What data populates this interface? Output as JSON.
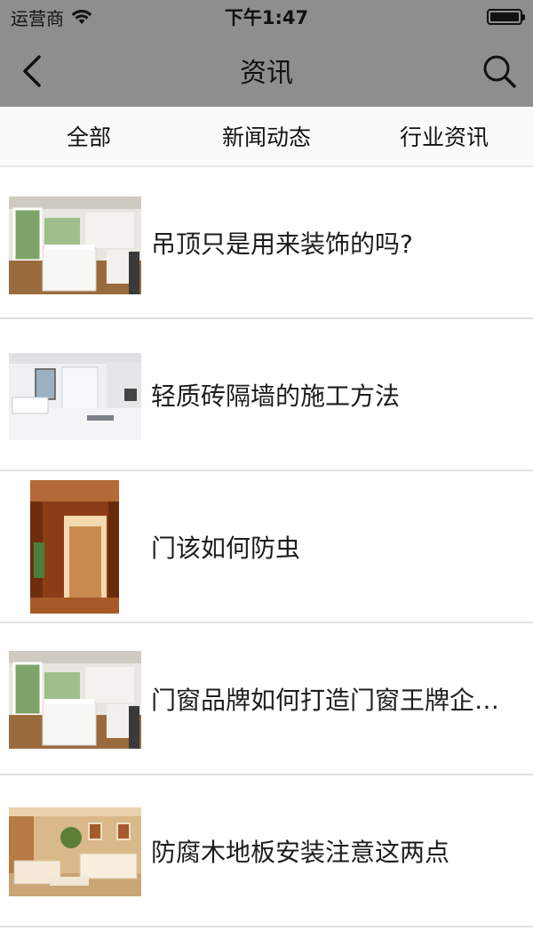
{
  "status": {
    "carrier": "运营商",
    "time": "下午1:47"
  },
  "nav": {
    "title": "资讯"
  },
  "tabs": [
    {
      "label": "全部"
    },
    {
      "label": "新闻动态"
    },
    {
      "label": "行业资讯"
    }
  ],
  "articles": [
    {
      "title": "吊顶只是用来装饰的吗?",
      "image": "kitchen-photo"
    },
    {
      "title": "轻质砖隔墙的施工方法",
      "image": "bathroom-photo"
    },
    {
      "title": "门该如何防虫",
      "image": "wooden-door-photo"
    },
    {
      "title": "门窗品牌如何打造门窗王牌企…",
      "image": "kitchen-photo"
    },
    {
      "title": "防腐木地板安装注意这两点",
      "image": "living-room-photo"
    }
  ],
  "colors": {
    "header_bg": "#8e8e8e",
    "tabs_bg": "#fafafa",
    "divider": "#e0e0e0"
  }
}
